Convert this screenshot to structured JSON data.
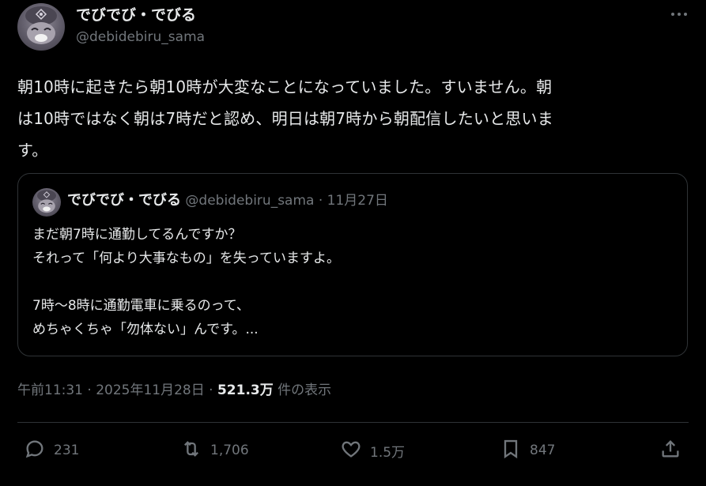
{
  "author": {
    "display_name": "でびでび・でびる",
    "handle": "@debidebiru_sama"
  },
  "icons": {
    "more": "more-icon",
    "reply": "reply-icon",
    "retweet": "retweet-icon",
    "like": "heart-icon",
    "bookmark": "bookmark-icon",
    "share": "share-icon"
  },
  "tweet": {
    "text": "朝10時に起きたら朝10時が大変なことになっていました。すいません。朝\nは10時ではなく朝は7時だと認め、明日は朝7時から朝配信したいと思いま\nす。"
  },
  "quoted": {
    "display_name": "でびでび・でびる",
    "handle": "@debidebiru_sama",
    "separator": "·",
    "date": "11月27日",
    "text": "まだ朝7時に通勤してるんですか？\nそれって「何より大事なもの」を失っていますよ。\n\n7時～8時に通勤電車に乗るのって、\nめちゃくちゃ「勿体ない」んです。..."
  },
  "meta": {
    "time": "午前11:31",
    "sep1": "·",
    "date": "2025年11月28日",
    "sep2": "·",
    "views": "521.3万",
    "views_label": "件の表示"
  },
  "actions": {
    "replies": "231",
    "retweets": "1,706",
    "likes": "1.5万",
    "bookmarks": "847"
  }
}
